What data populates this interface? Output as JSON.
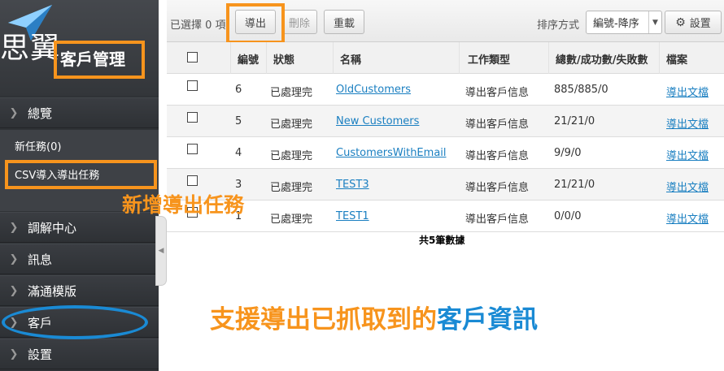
{
  "brand": {
    "logo_text": "思翼",
    "section_title": "客戶管理"
  },
  "sidebar": {
    "items": [
      {
        "label": "總覽"
      },
      {
        "label": "調解中心"
      },
      {
        "label": "訊息"
      },
      {
        "label": "滿通模版"
      },
      {
        "label": "客戶"
      },
      {
        "label": "設置"
      }
    ],
    "sub_items": [
      {
        "label": "新任務(0)"
      },
      {
        "label": "CSV導入導出任務"
      }
    ]
  },
  "toolbar": {
    "selected_text": "已選擇 0 項",
    "export_label": "導出",
    "delete_label": "刪除",
    "reload_label": "重載",
    "sort_label": "排序方式",
    "sort_value": "編號-降序",
    "settings_label": "設置"
  },
  "table": {
    "columns": [
      "編號",
      "狀態",
      "名稱",
      "工作類型",
      "總數/成功數/失敗數",
      "檔案"
    ],
    "rows": [
      {
        "id": "6",
        "status": "已處理完",
        "name": "OldCustomers",
        "type": "導出客戶信息",
        "counts": "885/885/0",
        "file": "導出文檔"
      },
      {
        "id": "5",
        "status": "已處理完",
        "name": "New Customers",
        "type": "導出客戶信息",
        "counts": "21/21/0",
        "file": "導出文檔"
      },
      {
        "id": "4",
        "status": "已處理完",
        "name": "CustomersWithEmail",
        "type": "導出客戶信息",
        "counts": "9/9/0",
        "file": "導出文檔"
      },
      {
        "id": "3",
        "status": "已處理完",
        "name": "TEST3",
        "type": "導出客戶信息",
        "counts": "21/21/0",
        "file": "導出文檔"
      },
      {
        "id": "1",
        "status": "已處理完",
        "name": "TEST1",
        "type": "導出客戶信息",
        "counts": "0/0/0",
        "file": "導出文檔"
      }
    ],
    "footer": "共5筆數據"
  },
  "annotations": {
    "new_export_task": "新增導出任務",
    "support_export_prefix": "支援導出已抓取到的",
    "support_export_highlight": "客戶資訊"
  },
  "colors": {
    "highlight": "#f7941d",
    "accent_blue": "#1a8ad4",
    "link": "#1a7fc1"
  },
  "icons": [
    "paper-plane-icon",
    "chevron-right-icon",
    "gear-icon",
    "chevron-down-icon",
    "collapse-handle-icon"
  ]
}
